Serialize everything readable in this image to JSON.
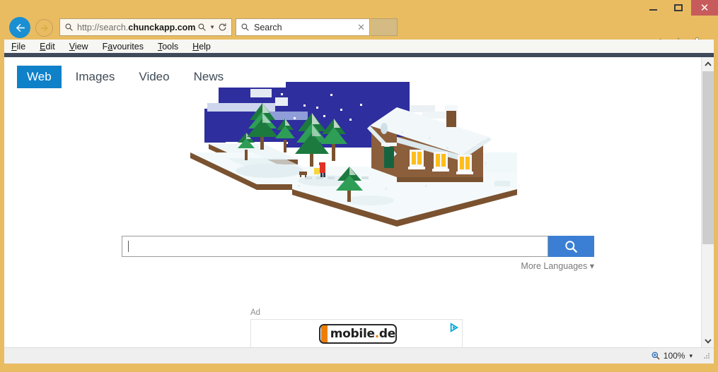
{
  "window": {
    "controls": {
      "minimize": "–",
      "maximize": "□",
      "close": "✕"
    }
  },
  "browser": {
    "back_label": "Back",
    "forward_label": "Forward",
    "address": {
      "prefix": "http://search.",
      "domain": "chunckapp.com",
      "suffix": "/",
      "full": "http://search.chunckapp.com/"
    },
    "search_box": {
      "placeholder": "Search",
      "value": "",
      "clear": "✕"
    },
    "icons": {
      "search": "search-icon",
      "dropdown": "dropdown-icon",
      "refresh": "refresh-icon",
      "home": "home-icon",
      "favorites": "star-icon",
      "settings": "gear-icon"
    },
    "menu": [
      {
        "accel": "F",
        "rest": "ile"
      },
      {
        "accel": "E",
        "rest": "dit"
      },
      {
        "accel": "V",
        "rest": "iew"
      },
      {
        "pre": "F",
        "accel": "a",
        "rest": "vourites"
      },
      {
        "accel": "T",
        "rest": "ools"
      },
      {
        "accel": "H",
        "rest": "elp"
      }
    ]
  },
  "page": {
    "tabs": [
      {
        "label": "Web",
        "active": true
      },
      {
        "label": "Images",
        "active": false
      },
      {
        "label": "Video",
        "active": false
      },
      {
        "label": "News",
        "active": false
      }
    ],
    "search": {
      "value": "",
      "placeholder": "",
      "button_icon": "search-icon"
    },
    "more_languages": "More Languages ▾",
    "ad": {
      "label": "Ad",
      "logo_text_main": "mobile",
      "logo_dot": ".",
      "logo_text_tld": "de",
      "adchoices_icon": "adchoices-icon"
    },
    "illustration": {
      "name": "winter-village-doodle",
      "description": "Isometric snowy landscape with pine trees, a house with lit windows and a person walking a dog under a starry night sky",
      "colors": {
        "sky": "#2e2e9e",
        "snow": "#f2f8f9",
        "snow_shadow": "#dfeaee",
        "ground_edge": "#7a5230",
        "tree_green": "#1c7a3f",
        "tree_green_light": "#2e9e57",
        "house_wall": "#8b5e3c",
        "house_wall_dark": "#7a5230",
        "window_light": "#ffcc33",
        "person_red": "#e03127"
      }
    }
  },
  "scrollbar": {
    "up": "⌃",
    "down": "⌄"
  },
  "status": {
    "zoom": "100%",
    "zoom_caret": "▾"
  }
}
